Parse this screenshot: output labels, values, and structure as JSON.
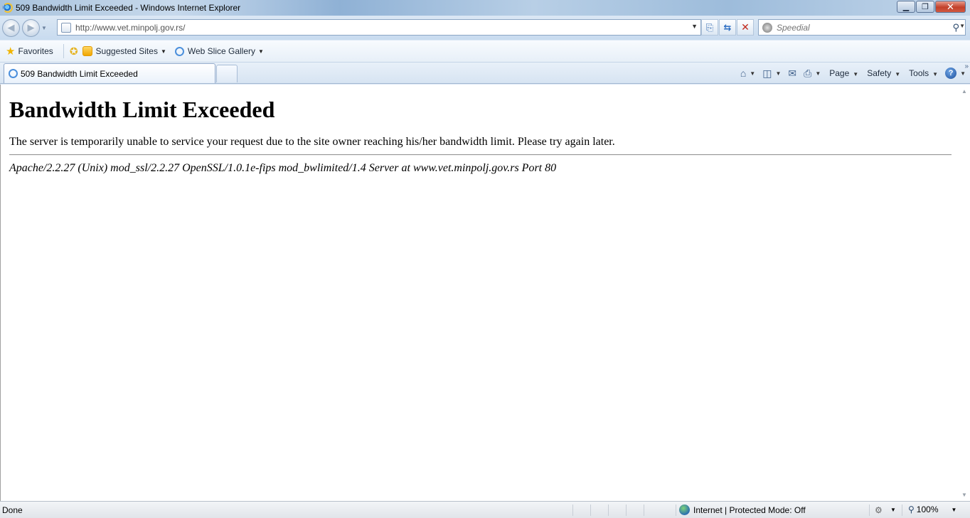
{
  "window": {
    "title": "509 Bandwidth Limit Exceeded - Windows Internet Explorer",
    "minimize_glyph": "▁",
    "maximize_glyph": "❐",
    "close_glyph": "✕"
  },
  "address_bar": {
    "url": "http://www.vet.minpolj.gov.rs/"
  },
  "search": {
    "placeholder": "Speedial"
  },
  "favorites_bar": {
    "favorites_label": "Favorites",
    "suggested_sites_label": "Suggested Sites",
    "web_slice_gallery_label": "Web Slice Gallery"
  },
  "tabs": [
    {
      "label": "509 Bandwidth Limit Exceeded"
    }
  ],
  "command_bar": {
    "page_label": "Page",
    "safety_label": "Safety",
    "tools_label": "Tools",
    "help_glyph": "?"
  },
  "page": {
    "heading": "Bandwidth Limit Exceeded",
    "message": "The server is temporarily unable to service your request due to the site owner reaching his/her bandwidth limit. Please try again later.",
    "server_signature": "Apache/2.2.27 (Unix) mod_ssl/2.2.27 OpenSSL/1.0.1e-fips mod_bwlimited/1.4 Server at www.vet.minpolj.gov.rs Port 80"
  },
  "status_bar": {
    "status": "Done",
    "zone": "Internet | Protected Mode: Off",
    "zoom": "100%"
  }
}
